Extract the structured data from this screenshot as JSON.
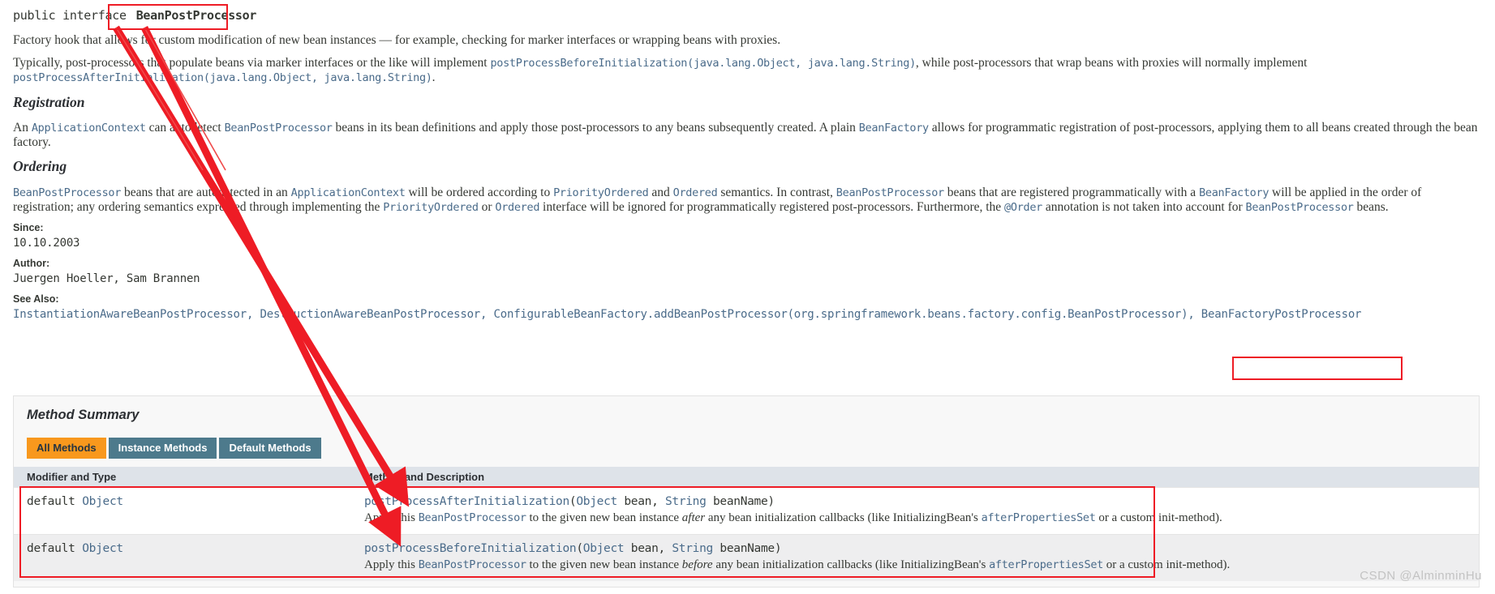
{
  "declaration": {
    "modifiers": "public interface",
    "class_name": "BeanPostProcessor"
  },
  "intro": {
    "paragraph1": "Factory hook that allows for custom modification of new bean instances — for example, checking for marker interfaces or wrapping beans with proxies.",
    "paragraph2_part1": "Typically, post-processors that populate beans via marker interfaces or the like will implement ",
    "paragraph2_code1": "postProcessBeforeInitialization(java.lang.Object, java.lang.String)",
    "paragraph2_part2": ", while post-processors that wrap beans with proxies will normally implement",
    "paragraph2_code2": "postProcessAfterInitialization(java.lang.Object, java.lang.String)",
    "paragraph2_part3": "."
  },
  "registration": {
    "heading": "Registration",
    "text_a": "An ",
    "code_a": "ApplicationContext",
    "text_b": " can autodetect ",
    "code_b": "BeanPostProcessor",
    "text_c": " beans in its bean definitions and apply those post-processors to any beans subsequently created. A plain ",
    "code_c": "BeanFactory",
    "text_d": " allows for programmatic registration of post-processors, applying them to all beans created through the bean",
    "text_e": "factory."
  },
  "ordering": {
    "heading": "Ordering",
    "line1_code1": "BeanPostProcessor",
    "line1_t1": " beans that are autodetected in an ",
    "line1_code2": "ApplicationContext",
    "line1_t2": " will be ordered according to ",
    "line1_code3": "PriorityOrdered",
    "line1_t3": " and ",
    "line1_code4": "Ordered",
    "line1_t4": " semantics. In contrast, ",
    "line1_code5": "BeanPostProcessor",
    "line1_t5": " beans that are registered programmatically with a ",
    "line1_code6": "BeanFactory",
    "line1_t6": " will be applied in the order of",
    "line2_t1": "registration; any ordering semantics expressed through implementing the ",
    "line2_code1": "PriorityOrdered",
    "line2_t2": " or ",
    "line2_code2": "Ordered",
    "line2_t3": " interface will be ignored for programmatically registered post-processors. Furthermore, the ",
    "line2_code3": "@Order",
    "line2_t4": " annotation is not taken into account for ",
    "line2_code4": "BeanPostProcessor",
    "line2_t5": " beans."
  },
  "meta": {
    "since_label": "Since:",
    "since_value": "10.10.2003",
    "author_label": "Author:",
    "author_value": "Juergen Hoeller, Sam Brannen",
    "see_also_label": "See Also:",
    "see_also_items": [
      "InstantiationAwareBeanPostProcessor",
      "DestructionAwareBeanPostProcessor",
      "ConfigurableBeanFactory.addBeanPostProcessor(org.springframework.beans.factory.config.BeanPostProcessor)",
      "BeanFactoryPostProcessor"
    ],
    "see_also_text": "InstantiationAwareBeanPostProcessor, DestructionAwareBeanPostProcessor, ConfigurableBeanFactory.addBeanPostProcessor(org.springframework.beans.factory.config.BeanPostProcessor), "
  },
  "method_summary": {
    "title": "Method Summary",
    "tabs": [
      {
        "label": "All Methods",
        "active": true
      },
      {
        "label": "Instance Methods",
        "active": false
      },
      {
        "label": "Default Methods",
        "active": false
      }
    ],
    "columns": [
      "Modifier and Type",
      "Method and Description"
    ],
    "rows": [
      {
        "modifier": "default ",
        "type": "Object",
        "method_name": "postProcessAfterInitialization",
        "signature_open": "(",
        "param1_type": "Object",
        "param1_name": " bean, ",
        "param2_type": "String",
        "param2_name": " beanName",
        "signature_close": ")",
        "desc_a": "Apply this ",
        "desc_code1": "BeanPostProcessor",
        "desc_b": " to the given new bean instance ",
        "desc_em": "after",
        "desc_c": " any bean initialization callbacks (like InitializingBean's ",
        "desc_code2": "afterPropertiesSet",
        "desc_d": " or a custom init-method)."
      },
      {
        "modifier": "default ",
        "type": "Object",
        "method_name": "postProcessBeforeInitialization",
        "signature_open": "(",
        "param1_type": "Object",
        "param1_name": " bean, ",
        "param2_type": "String",
        "param2_name": " beanName",
        "signature_close": ")",
        "desc_a": "Apply this ",
        "desc_code1": "BeanPostProcessor",
        "desc_b": " to the given new bean instance ",
        "desc_em": "before",
        "desc_c": " any bean initialization callbacks (like InitializingBean's ",
        "desc_code2": "afterPropertiesSet",
        "desc_d": " or a custom init-method)."
      }
    ]
  },
  "annotations": {
    "highlight_color": "#ee1c25",
    "accent_active_tab": "#f8981d",
    "accent_tab": "#4d7a8c"
  },
  "watermark": "CSDN @AlminminHu"
}
